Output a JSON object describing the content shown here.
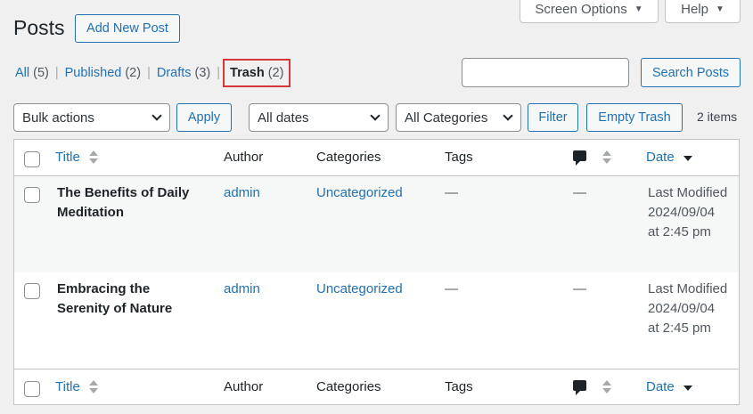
{
  "header": {
    "screen_options": "Screen Options",
    "help": "Help",
    "title": "Posts",
    "add_new": "Add New Post"
  },
  "filters_nav": {
    "all": {
      "label": "All",
      "count": "(5)"
    },
    "published": {
      "label": "Published",
      "count": "(2)"
    },
    "drafts": {
      "label": "Drafts",
      "count": "(3)"
    },
    "trash": {
      "label": "Trash",
      "count": "(2)"
    },
    "separator": "|"
  },
  "search": {
    "value": "",
    "button": "Search Posts"
  },
  "tablenav": {
    "bulk_actions": "Bulk actions",
    "apply": "Apply",
    "dates": "All dates",
    "categories": "All Categories",
    "filter": "Filter",
    "empty_trash": "Empty Trash",
    "items_count": "2 items"
  },
  "columns": {
    "title": "Title",
    "author": "Author",
    "categories": "Categories",
    "tags": "Tags",
    "date": "Date"
  },
  "rows": [
    {
      "title_line1": "The Benefits of Daily",
      "title_line2": "Meditation",
      "author": "admin",
      "category": "Uncategorized",
      "tags": "—",
      "comments": "—",
      "date_line1": "Last Modified",
      "date_line2": "2024/09/04",
      "date_line3": "at 2:45 pm"
    },
    {
      "title_line1": "Embracing the",
      "title_line2": "Serenity of Nature",
      "author": "admin",
      "category": "Uncategorized",
      "tags": "—",
      "comments": "—",
      "date_line1": "Last Modified",
      "date_line2": "2024/09/04",
      "date_line3": "at 2:45 pm"
    }
  ],
  "icons": {
    "comments": "comment-bubble-icon",
    "sort": "sort-arrows-icon",
    "dropdown": "chevron-down-icon"
  },
  "colors": {
    "link": "#2271b1",
    "highlight": "#d63638",
    "background": "#f0f0f1"
  }
}
